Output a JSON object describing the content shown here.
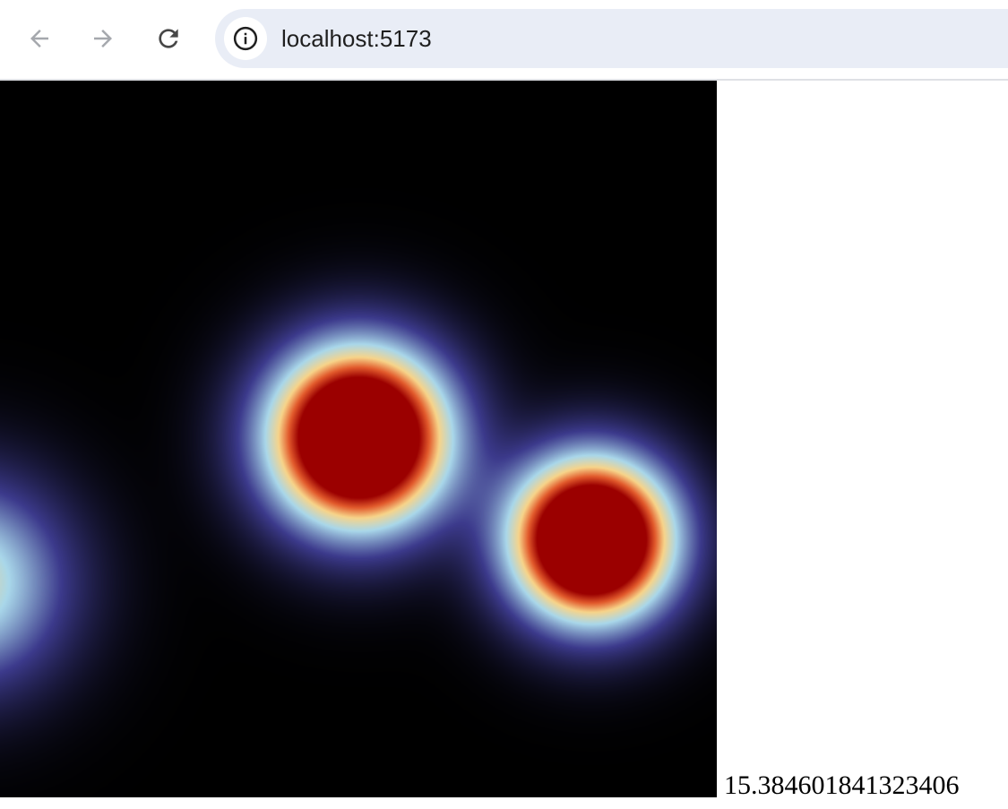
{
  "browser": {
    "url": "localhost:5173",
    "icons": {
      "back": "arrow-left-icon",
      "forward": "arrow-right-icon",
      "reload": "reload-icon",
      "site_info": "info-icon"
    }
  },
  "page": {
    "readout_value": "15.384601841323406",
    "heatmap": {
      "colormap": [
        "#000000",
        "#3c3a8c",
        "#a9d7ea",
        "#f7d48a",
        "#e25a2c",
        "#9b0000"
      ],
      "background": "#000000"
    }
  }
}
